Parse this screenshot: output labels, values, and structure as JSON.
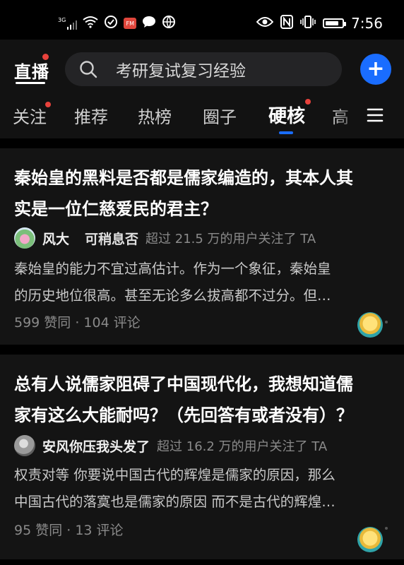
{
  "status_bar": {
    "network_type": "3G",
    "fm_label": "FM",
    "time": "7:56"
  },
  "header": {
    "live_label": "直播",
    "search_placeholder": "考研复试复习经验",
    "add_label": "+"
  },
  "tabs": [
    {
      "label": "关注",
      "has_dot": true
    },
    {
      "label": "推荐",
      "has_dot": false
    },
    {
      "label": "热榜",
      "has_dot": false
    },
    {
      "label": "圈子",
      "has_dot": false
    },
    {
      "label": "硬核",
      "has_dot": true,
      "active": true
    },
    {
      "label": "高",
      "has_dot": false
    }
  ],
  "feed": [
    {
      "title_line1": "秦始皇的黑料是否都是儒家编造的，其本人其",
      "title_line2": "实是一位仁慈爱民的君主？",
      "author": "风大",
      "author_sub": "可稍息否",
      "followers": "超过 21.5 万的用户关注了 TA",
      "excerpt_line1": "秦始皇的能力不宜过高估计。作为一个象征，秦始皇",
      "excerpt_line2": "的历史地位很高。甚至无论多么拔高都不过分。但…",
      "stats": "599 赞同 · 104 评论"
    },
    {
      "title_line1": "总有人说儒家阻碍了中国现代化，我想知道儒",
      "title_line2": "家有这么大能耐吗？（先回答有或者没有）？",
      "author": "安风你压我头发了",
      "followers": "超过 16.2 万的用户关注了 TA",
      "excerpt_line1": "权责对等 你要说中国古代的辉煌是儒家的原因，那么",
      "excerpt_line2": "中国古代的落寞也是儒家的原因 而不是古代的辉煌…",
      "stats": "95 赞同 · 13 评论"
    }
  ],
  "colors": {
    "accent_blue": "#1a6dff",
    "notify_red": "#e8423c",
    "card_bg": "#141414",
    "header_bg": "#121212"
  }
}
